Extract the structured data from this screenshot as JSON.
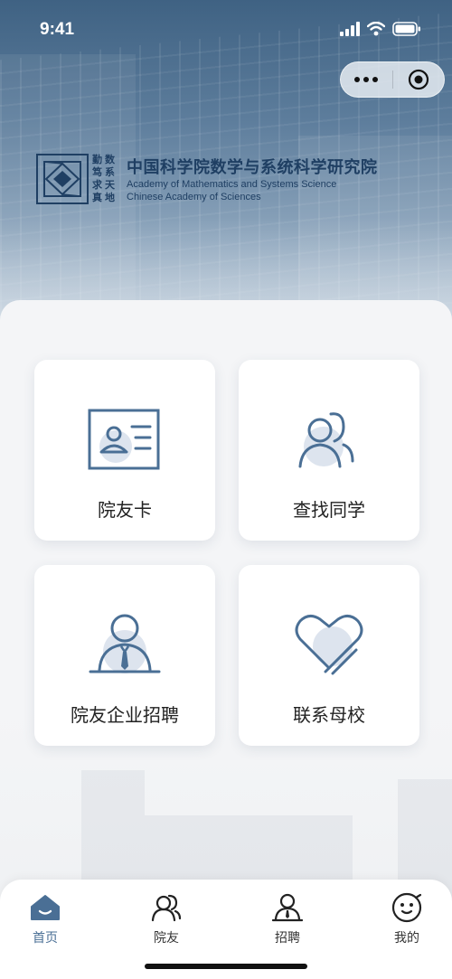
{
  "status_bar": {
    "time": "9:41"
  },
  "header": {
    "logo_motto": [
      "勤",
      "数",
      "笃",
      "系",
      "求",
      "天",
      "真",
      "地"
    ],
    "org_name_cn": "中国科学院数学与系统科学研究院",
    "org_name_en_1": "Academy of Mathematics and Systems Science",
    "org_name_en_2": "Chinese Academy of Sciences"
  },
  "cards": [
    {
      "label": "院友卡",
      "icon": "id-card-icon"
    },
    {
      "label": "查找同学",
      "icon": "people-icon"
    },
    {
      "label": "院友企业招聘",
      "icon": "person-tie-icon"
    },
    {
      "label": "联系母校",
      "icon": "heart-icon"
    }
  ],
  "tabbar": {
    "items": [
      {
        "label": "首页",
        "icon": "home-icon",
        "active": true
      },
      {
        "label": "院友",
        "icon": "people-icon",
        "active": false
      },
      {
        "label": "招聘",
        "icon": "person-tie-icon",
        "active": false
      },
      {
        "label": "我的",
        "icon": "smiley-icon",
        "active": false
      }
    ]
  },
  "colors": {
    "accent": "#4a6f95",
    "brand_dark": "#1f3f63",
    "icon_fill": "#dde4ee"
  }
}
